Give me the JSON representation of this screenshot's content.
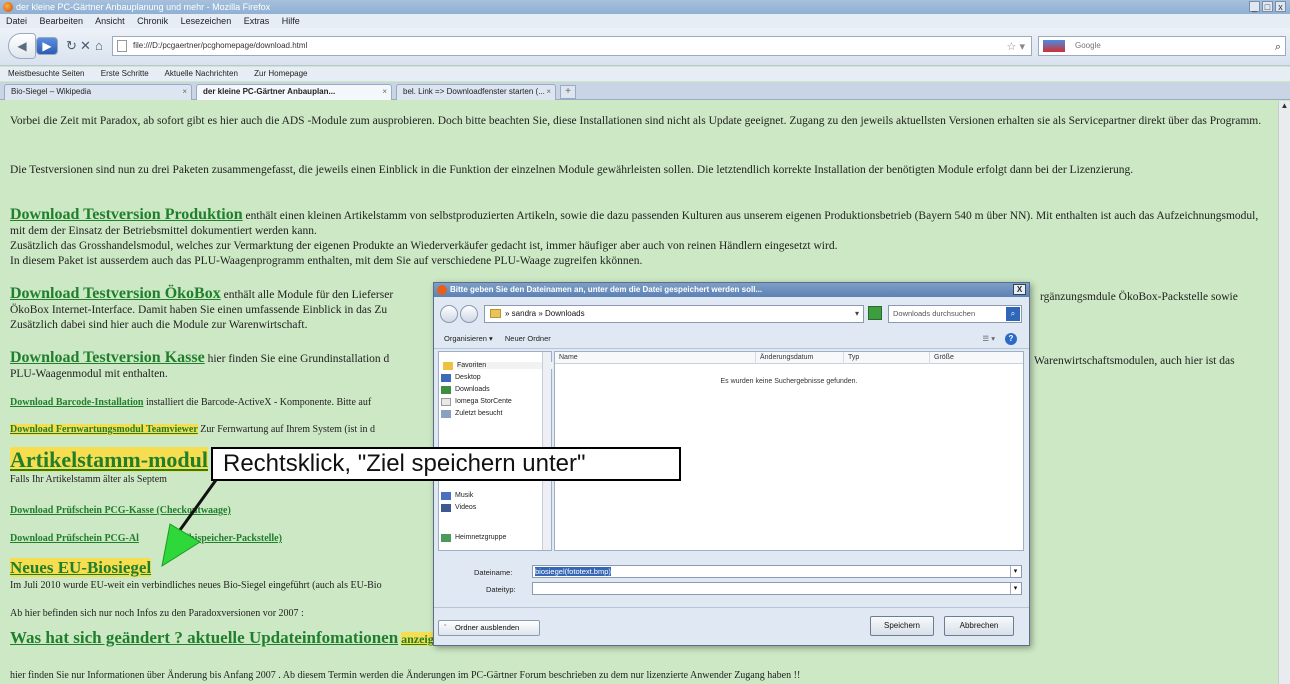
{
  "window": {
    "title": "der kleine PC-Gärtner Anbauplanung und mehr - Mozilla Firefox",
    "controls": [
      "_",
      "□",
      "x"
    ]
  },
  "menu": [
    "Datei",
    "Bearbeiten",
    "Ansicht",
    "Chronik",
    "Lesezeichen",
    "Extras",
    "Hilfe"
  ],
  "nav": {
    "url": "file:///D:/pcgaertner/pcghomepage/download.html",
    "search_placeholder": "Google"
  },
  "bookmarks": [
    "Meistbesuchte Seiten",
    "Erste Schritte",
    "Aktuelle Nachrichten",
    "Zur Homepage"
  ],
  "tabs": [
    {
      "label": "Bio-Siegel – Wikipedia"
    },
    {
      "label": "der kleine PC-Gärtner Anbauplan..."
    },
    {
      "label": "bel. Link => Downloadfenster starten (..."
    }
  ],
  "page": {
    "intro1": "Vorbei die Zeit mit Paradox, ab sofort gibt es hier auch  die ADS -Module zum ausprobieren. Doch bitte beachten Sie, diese Installationen sind nicht als Update geeignet. Zugang zu den jeweils aktuellsten Versionen erhalten sie als Servicepartner direkt über das Programm.",
    "intro2": "Die Testversionen sind nun zu drei Paketen zusammengefasst, die jeweils einen Einblick in die Funktion der einzelnen Module gewährleisten sollen. Die letztendlich korrekte Installation der benötigten Module erfolgt dann bei der Lizenzierung.",
    "dl_produktion": "Download Testversion Produktion",
    "dl_produktion_text1": " enthält einen kleinen Artikelstamm von selbstproduzierten Artikeln, sowie die dazu passenden Kulturen aus unserem eigenen Produktionsbetrieb (Bayern 540 m über NN). Mit enthalten ist auch das Aufzeichnungsmodul, mit dem der Einsatz der Betriebsmittel dokumentiert werden kann.",
    "dl_produktion_text2": "Zusätzlich das Grosshandelsmodul, welches zur Vermarktung der eigenen Produkte an Wiederverkäufer gedacht ist, immer häufiger aber auch von reinen Händlern eingesetzt wird.",
    "dl_produktion_text3": "In diesem Paket ist ausserdem auch das PLU-Waagenprogramm enthalten, mit dem Sie auf verschiedene PLU-Waage zugreifen kkönnen.",
    "dl_oekobox": "Download Testversion ÖkoBox",
    "dl_oekobox_text1": " enthält alle Module für den Lieferser",
    "dl_oekobox_text1b": "rgänzungsmdule ÖkoBox-Packstelle sowie",
    "dl_oekobox_text2": "ÖkoBox Internet-Interface. Damit haben Sie einen umfassende Einblick in das Zu",
    "dl_oekobox_text3": "Zusätzlich dabei sind hier auch die Module zur Warenwirtschaft.",
    "dl_kasse": "Download Testversion Kasse",
    "dl_kasse_text1": "  hier finden Sie eine Grundinstallation d",
    "dl_kasse_text1b": "Warenwirtschaftsmodulen, auch hier ist das",
    "dl_kasse_text2": "PLU-Waagenmodul mit enthalten.",
    "dl_barcode": "Download Barcode-Installation",
    "dl_barcode_text": " installiert die Barcode-ActiveX - Komponente. Bitte auf",
    "dl_fernwartung": "Download Fernwartungsmodul Teamviewer",
    "dl_fernwartung_text": " Zur Fernwartung auf Ihrem System (ist in d",
    "artikelstamm": "Artikelstamm-modul",
    "artikelstamm_text": "Falls Ihr Artikelstamm älter als Septem",
    "pruef_kasse": "Download Prüfschein PCG-Kasse (Checkoutwaage)",
    "pruef_al": "Download Prüfschein PCG-Al",
    "pruef_al_b": "(Alibispeicher-Packstelle)",
    "eu_bio": "Neues EU-Biosiegel",
    "eu_bio_text": "Im Juli 2010 wurde EU-weit ein verbindliches neues Bio-Siegel eingeführt (auch als EU-Bio",
    "ab_hier": "Ab hier befinden sich nur noch Infos zu den Paradoxversionen vor 2007 :",
    "was_hat": "Was hat sich geändert ? aktuelle Updateinfomationen",
    "was_hat_tail": "anzeigen",
    "hier_finden": "hier finden Sie nur Informationen über Änderung bis Anfang 2007 . Ab diesem Termin werden die Änderungen im PC-Gärtner Forum beschrieben zu dem nur lizenzierte Anwender Zugang haben !!"
  },
  "dialog": {
    "title": "Bitte geben Sie den Dateinamen an, unter dem die Datei gespeichert werden soll...",
    "path": "» sandra » Downloads",
    "search": "Downloads durchsuchen",
    "organize": "Organisieren ▾",
    "new_folder": "Neuer Ordner",
    "sidebar": [
      "Favoriten",
      "Desktop",
      "Downloads",
      "Iomega StorCente",
      "Zuletzt besucht",
      "Musik",
      "Videos",
      "Heimnetzgruppe"
    ],
    "columns": [
      "Name",
      "Änderungsdatum",
      "Typ",
      "Größe"
    ],
    "empty": "Es wurden keine Suchergebnisse gefunden.",
    "filename_label": "Dateiname:",
    "filename_value": "biosiegel(fototext.bmp)",
    "filetype_label": "Dateityp:",
    "hide_folders": "Ordner ausblenden",
    "save": "Speichern",
    "cancel": "Abbrechen"
  },
  "annotation": {
    "text": "Rechtsklick, \"Ziel speichern unter\"",
    "arrow_color": "#2fd83a"
  }
}
